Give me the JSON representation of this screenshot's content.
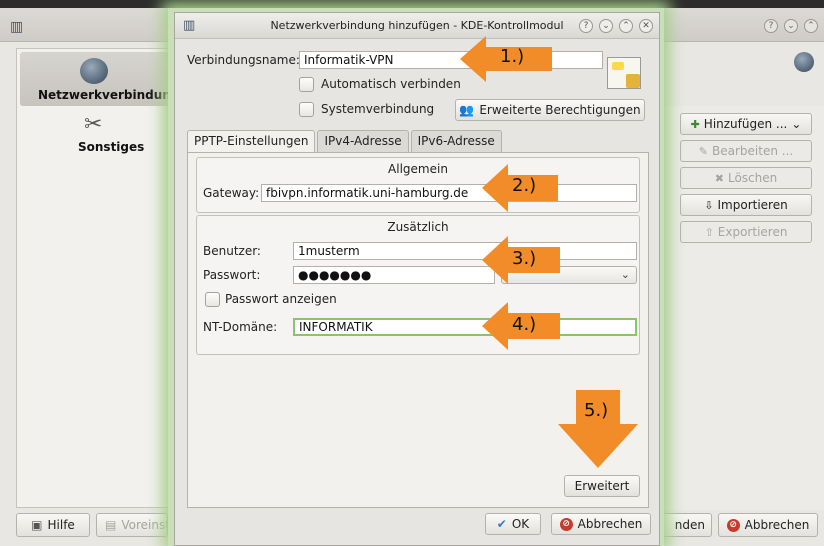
{
  "background_window": {
    "modules": [
      {
        "label": "Netzwerkverbindungen"
      },
      {
        "label": "Sonstiges"
      }
    ],
    "side_buttons": {
      "add": "Hinzufügen ...",
      "edit": "Bearbeiten ...",
      "delete": "Löschen",
      "import": "Importieren",
      "export": "Exportieren"
    },
    "bottom": {
      "help": "Hilfe",
      "defaults": "Voreinstellungen",
      "apply": "nden",
      "cancel": "Abbrechen"
    }
  },
  "dialog": {
    "title": "Netzwerkverbindung hinzufügen - KDE-Kontrollmodul",
    "connection_name_label": "Verbindungsname:",
    "connection_name_value": "Informatik-VPN",
    "auto_connect_label": "Automatisch verbinden",
    "system_connection_label": "Systemverbindung",
    "advanced_permissions_label": "Erweiterte Berechtigungen",
    "tabs": [
      "PPTP-Einstellungen",
      "IPv4-Adresse",
      "IPv6-Adresse"
    ],
    "general": {
      "title": "Allgemein",
      "gateway_label": "Gateway:",
      "gateway_value": "fbivpn.informatik.uni-hamburg.de"
    },
    "additional": {
      "title": "Zusätzlich",
      "user_label": "Benutzer:",
      "user_value": "1musterm",
      "password_label": "Passwort:",
      "password_value": "●●●●●●●",
      "show_password_label": "Passwort anzeigen",
      "nt_domain_label": "NT-Domäne:",
      "nt_domain_value": "INFORMATIK"
    },
    "advanced_button": "Erweitert",
    "ok_button": "OK",
    "cancel_button": "Abbrechen"
  },
  "annotations": [
    "1.)",
    "2.)",
    "3.)",
    "4.)",
    "5.)"
  ],
  "colors": {
    "arrow": "#f28c28",
    "focus_border": "#8bc36a",
    "dialog_glow": "#a7cf8c"
  }
}
